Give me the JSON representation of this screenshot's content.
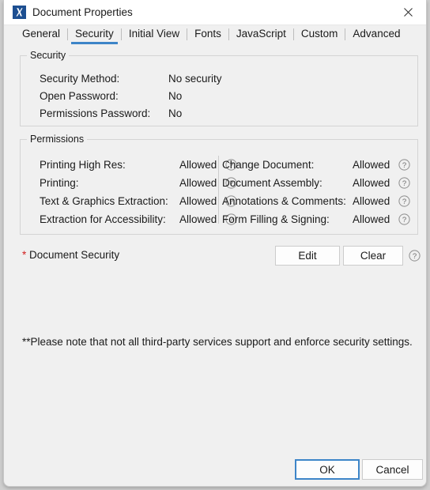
{
  "window": {
    "title": "Document Properties",
    "app_icon": "pdf-xchange-icon",
    "close_icon": "close-icon",
    "accent_color": "#3d85c8",
    "background_color": "#f0f0f0",
    "asterisk_color": "#d11f1f"
  },
  "tabs": [
    {
      "label": "General",
      "active": false
    },
    {
      "label": "Security",
      "active": true
    },
    {
      "label": "Initial View",
      "active": false
    },
    {
      "label": "Fonts",
      "active": false
    },
    {
      "label": "JavaScript",
      "active": false
    },
    {
      "label": "Custom",
      "active": false
    },
    {
      "label": "Advanced",
      "active": false
    }
  ],
  "security_group": {
    "title": "Security",
    "rows": [
      {
        "label": "Security Method:",
        "value": "No security"
      },
      {
        "label": "Open Password:",
        "value": "No"
      },
      {
        "label": "Permissions Password:",
        "value": "No"
      }
    ]
  },
  "permissions_group": {
    "title": "Permissions",
    "help_icon": "help-circle-icon",
    "left_column": [
      {
        "label": "Printing High Res:",
        "value": "Allowed"
      },
      {
        "label": "Printing:",
        "value": "Allowed"
      },
      {
        "label": "Text & Graphics Extraction:",
        "value": "Allowed"
      },
      {
        "label": "Extraction for Accessibility:",
        "value": "Allowed"
      }
    ],
    "right_column": [
      {
        "label": "Change Document:",
        "value": "Allowed"
      },
      {
        "label": "Document Assembly:",
        "value": "Allowed"
      },
      {
        "label": "Annotations & Comments:",
        "value": "Allowed"
      },
      {
        "label": "Form Filling & Signing:",
        "value": "Allowed"
      }
    ]
  },
  "document_security": {
    "asterisk": "*",
    "label": "Document Security",
    "edit_label": "Edit",
    "clear_label": "Clear",
    "help_icon": "help-circle-icon"
  },
  "note": {
    "text": "**Please note that not all third-party services support and enforce security settings."
  },
  "footer": {
    "ok_label": "OK",
    "cancel_label": "Cancel"
  }
}
